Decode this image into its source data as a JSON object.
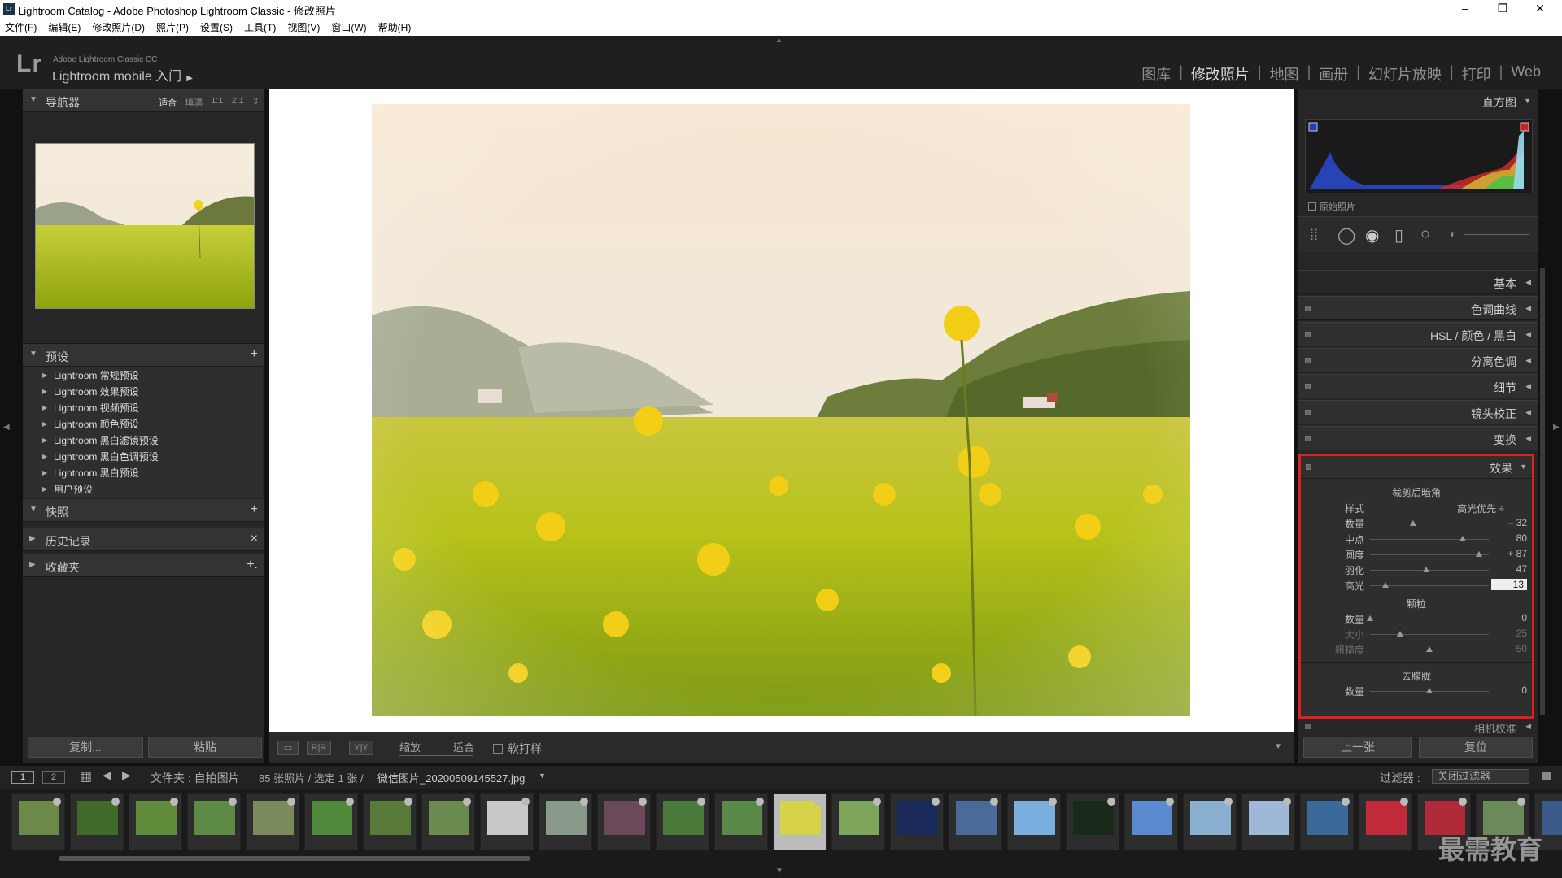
{
  "window": {
    "title": "Lightroom Catalog - Adobe Photoshop Lightroom Classic - 修改照片",
    "app_badge": "Lr",
    "min": "–",
    "restore": "❐",
    "close": "✕"
  },
  "menu": [
    "文件(F)",
    "编辑(E)",
    "修改照片(D)",
    "照片(P)",
    "设置(S)",
    "工具(T)",
    "视图(V)",
    "窗口(W)",
    "帮助(H)"
  ],
  "brand": {
    "logo": "Lr",
    "line1": "Adobe Lightroom Classic CC",
    "line2": "Lightroom mobile 入门",
    "arrow": "▶"
  },
  "modules": [
    "图库",
    "修改照片",
    "地图",
    "画册",
    "幻灯片放映",
    "打印",
    "Web"
  ],
  "active_module": "修改照片",
  "left": {
    "navigator": {
      "title": "导航器",
      "zooms": [
        "适合",
        "填满",
        "1:1",
        "2:1",
        "⇕"
      ]
    },
    "presets": {
      "title": "预设",
      "action": "+",
      "items": [
        "Lightroom 常规预设",
        "Lightroom 效果预设",
        "Lightroom 视频预设",
        "Lightroom 颜色预设",
        "Lightroom 黑白滤镜预设",
        "Lightroom 黑白色调预设",
        "Lightroom 黑白预设",
        "用户预设"
      ]
    },
    "snapshots": {
      "title": "快照",
      "action": "+"
    },
    "history": {
      "title": "历史记录",
      "action": "×"
    },
    "collections": {
      "title": "收藏夹",
      "action": "+."
    },
    "copy_button": "复制...",
    "paste_button": "粘贴"
  },
  "toolbar": {
    "view_btns": [
      "▭",
      "R|R",
      "Y|Y"
    ],
    "zoom_label": "缩放",
    "fit_label": "适合",
    "softproof": "软打样"
  },
  "right": {
    "histogram": {
      "title": "直方图",
      "original_label": "原始照片"
    },
    "panels": [
      {
        "name": "基本"
      },
      {
        "name": "色调曲线"
      },
      {
        "name": "HSL / 颜色 / 黑白"
      },
      {
        "name": "分离色调"
      },
      {
        "name": "细节"
      },
      {
        "name": "镜头校正"
      },
      {
        "name": "变换"
      }
    ],
    "effects": {
      "title": "效果",
      "vignette": {
        "title": "裁剪后暗角",
        "style_label": "样式",
        "style_value": "高光优先 ÷",
        "sliders": [
          {
            "name": "数量",
            "value": "– 32",
            "pos": 0.36
          },
          {
            "name": "中点",
            "value": "80",
            "pos": 0.78
          },
          {
            "name": "圆度",
            "value": "+ 87",
            "pos": 0.92
          },
          {
            "name": "羽化",
            "value": "47",
            "pos": 0.47
          },
          {
            "name": "高光",
            "value": "13",
            "pos": 0.13
          }
        ]
      },
      "grain": {
        "title": "颗粒",
        "sliders": [
          {
            "name": "数量",
            "value": "0",
            "pos": 0.0
          },
          {
            "name": "大小",
            "value": "25",
            "pos": 0.25
          },
          {
            "name": "粗糙度",
            "value": "50",
            "pos": 0.5
          }
        ]
      },
      "dehaze": {
        "title": "去朦胧",
        "sliders": [
          {
            "name": "数量",
            "value": "0",
            "pos": 0.5
          }
        ]
      }
    },
    "camera_calibration": "相机校准",
    "prev_button": "上一张",
    "reset_button": "复位"
  },
  "filmbar": {
    "page1": "1",
    "page2": "2",
    "path": "文件夹 : 自拍图片",
    "count": "85 张照片 / 选定 1 张 /",
    "filename": "微信图片_20200509145527.jpg",
    "filter_label": "过滤器 :",
    "filter_value": "关闭过滤器"
  },
  "watermark": "最需教育",
  "colors": {
    "highlight_border": "#e02020",
    "active_module": "#dddddd"
  }
}
